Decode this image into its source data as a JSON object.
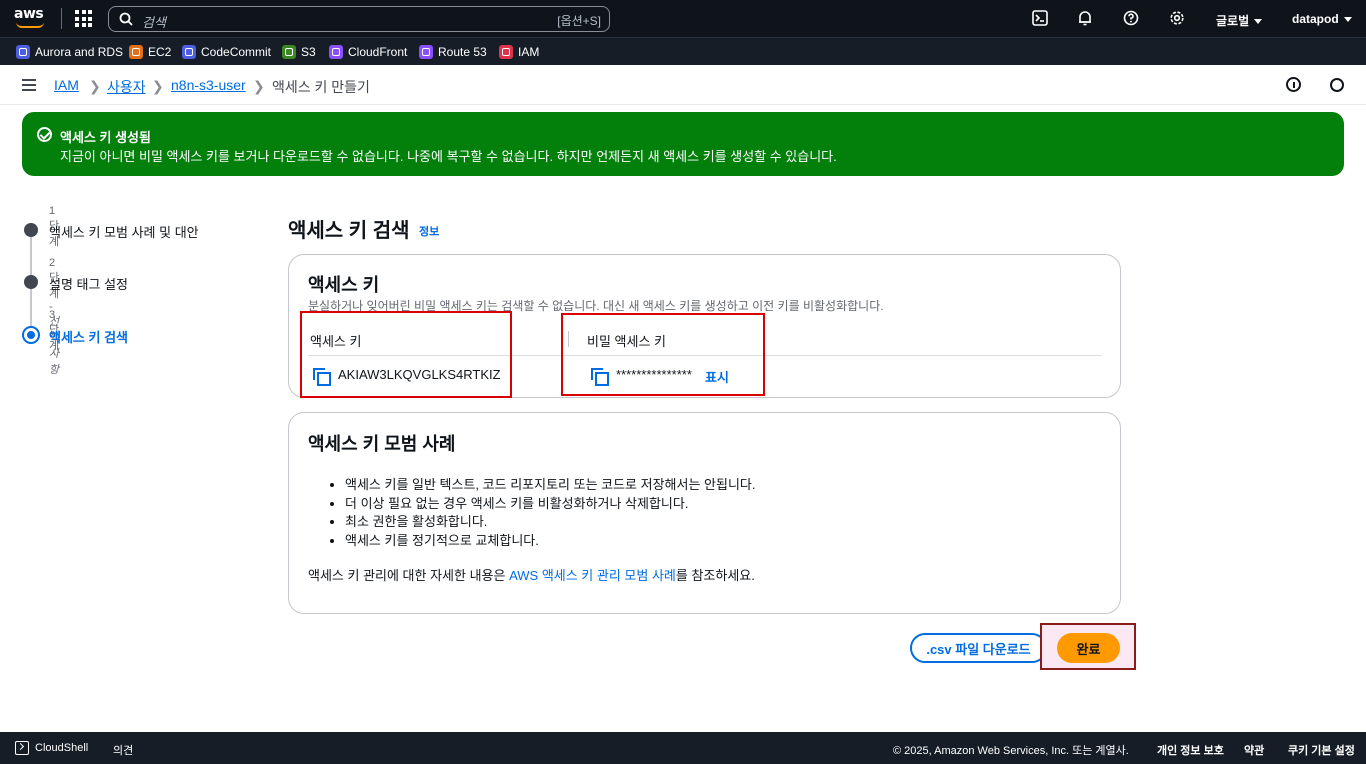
{
  "topnav": {
    "logo_text": "aws",
    "search_placeholder": "검색",
    "search_shortcut": "[옵션+S]",
    "region": "글로벌",
    "account": "datapod",
    "icons": [
      "cloudshell-icon",
      "bell-icon",
      "help-icon",
      "gear-icon"
    ]
  },
  "favorites": [
    {
      "label": "Aurora and RDS",
      "color": "#4d5fde"
    },
    {
      "label": "EC2",
      "color": "#e0711a"
    },
    {
      "label": "CodeCommit",
      "color": "#4d5fde"
    },
    {
      "label": "S3",
      "color": "#3f8624"
    },
    {
      "label": "CloudFront",
      "color": "#8c4fff"
    },
    {
      "label": "Route 53",
      "color": "#8c4fff"
    },
    {
      "label": "IAM",
      "color": "#dd344c"
    }
  ],
  "breadcrumb": {
    "items": [
      "IAM",
      "사용자",
      "n8n-s3-user"
    ],
    "current": "액세스 키 만들기"
  },
  "flash": {
    "title": "액세스 키 생성됨",
    "message": "지금이 아니면 비밀 액세스 키를 보거나 다운로드할 수 없습니다. 나중에 복구할 수 없습니다. 하지만 언제든지 새 액세스 키를 생성할 수 있습니다.",
    "color": "#037f0c"
  },
  "steps": [
    {
      "num": "1단계",
      "optional": "",
      "label": "액세스 키 모범 사례 및 대안"
    },
    {
      "num": "2단계",
      "optional": " - 선택 사항",
      "label": "설명 태그 설정"
    },
    {
      "num": "3단계",
      "optional": "",
      "label": "액세스 키 검색"
    }
  ],
  "main": {
    "title": "액세스 키 검색",
    "info": "정보"
  },
  "access_key_card": {
    "title": "액세스 키",
    "description": "분실하거나 잊어버린 비밀 액세스 키는 검색할 수 없습니다. 대신 새 액세스 키를 생성하고 이전 키를 비활성화합니다.",
    "col1_header": "액세스 키",
    "col1_value": "AKIAW3LKQVGLKS4RTKIZ",
    "col2_header": "비밀 액세스 키",
    "col2_value": "***************",
    "show_label": "표시"
  },
  "best_practices": {
    "title": "액세스 키 모범 사례",
    "bullets": [
      "액세스 키를 일반 텍스트, 코드 리포지토리 또는 코드로 저장해서는 안됩니다.",
      "더 이상 필요 없는 경우 액세스 키를 비활성화하거나 삭제합니다.",
      "최소 권한을 활성화합니다.",
      "액세스 키를 정기적으로 교체합니다."
    ],
    "more_prefix": "액세스 키 관리에 대한 자세한 내용은 ",
    "more_link": "AWS 액세스 키 관리 모범 사례",
    "more_suffix": "를 참조하세요."
  },
  "buttons": {
    "download_csv": ".csv 파일 다운로드",
    "done": "완료"
  },
  "footer": {
    "cloudshell": "CloudShell",
    "feedback": "의견",
    "copyright": "© 2025, Amazon Web Services, Inc. 또는 계열사.",
    "privacy": "개인 정보 보호",
    "terms": "약관",
    "cookies": "쿠키 기본 설정"
  }
}
